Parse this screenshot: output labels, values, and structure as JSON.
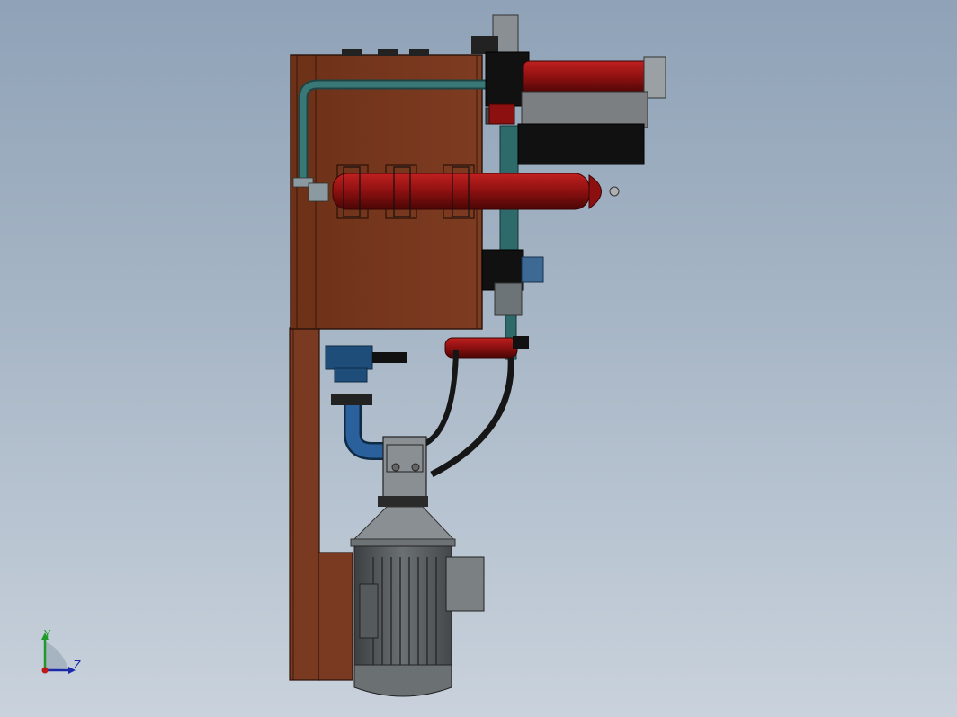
{
  "viewport": {
    "background_top": "#8fa2b7",
    "background_bottom": "#c9d2dc"
  },
  "model": {
    "description_colors": {
      "tank": "#7a3a22",
      "tank_edge": "#3a1a0c",
      "accumulator": "#8c1010",
      "pipe": "#2e6a6a",
      "motor": "#5d6164",
      "pump_block": "#1f4d7a",
      "hose": "#1a1a1a"
    }
  },
  "triad": {
    "y_label": "Y",
    "z_label": "Z",
    "y_color": "#1f9a2a",
    "z_color": "#1b2aa8",
    "origin_color": "#c01818"
  }
}
